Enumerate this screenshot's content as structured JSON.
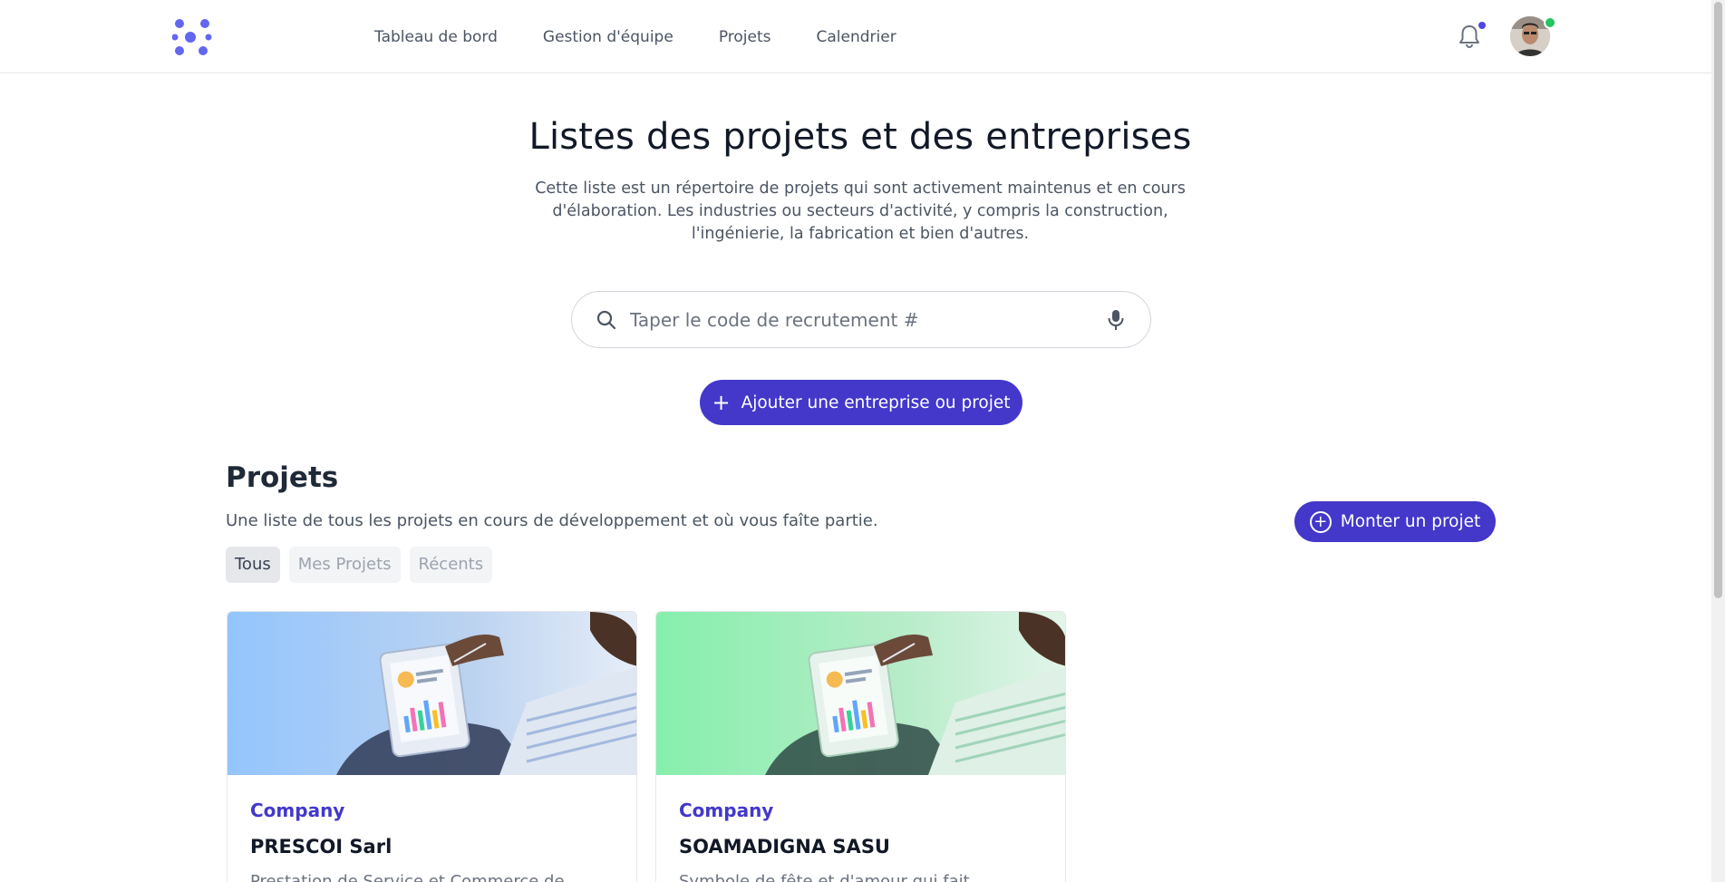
{
  "header": {
    "logo_icon": "app-logo-icon",
    "nav": [
      {
        "label": "Tableau de bord"
      },
      {
        "label": "Gestion d'équipe"
      },
      {
        "label": "Projets"
      },
      {
        "label": "Calendrier"
      }
    ],
    "notification_icon": "bell-icon",
    "avatar_icon": "user-avatar"
  },
  "hero": {
    "title": "Listes des projets et des entreprises",
    "subtitle": "Cette liste est un répertoire de projets qui sont activement maintenus et en cours d'élaboration. Les industries ou secteurs d'activité, y compris la construction, l'ingénierie, la fabrication et bien d'autres.",
    "search": {
      "placeholder": "Taper le code de recrutement #",
      "value": ""
    },
    "add_button": "Ajouter une entreprise ou projet"
  },
  "projects": {
    "title": "Projets",
    "description": "Une liste de tous les projets en cours de développement et où vous faîte partie.",
    "mount_button": "Monter un projet",
    "filters": [
      {
        "label": "Tous",
        "active": true
      },
      {
        "label": "Mes Projets",
        "active": false
      },
      {
        "label": "Récents",
        "active": false
      }
    ],
    "cards": [
      {
        "category": "Company",
        "name": "PRESCOI Sarl",
        "description": "Prestation de Service et Commerce de",
        "tint": "#93c5fd"
      },
      {
        "category": "Company",
        "name": "SOAMADIGNA SASU",
        "description": "Symbole de fête et d'amour qui fait",
        "tint": "#86efac"
      }
    ]
  },
  "colors": {
    "accent": "#4338ca",
    "online": "#22c55e"
  }
}
